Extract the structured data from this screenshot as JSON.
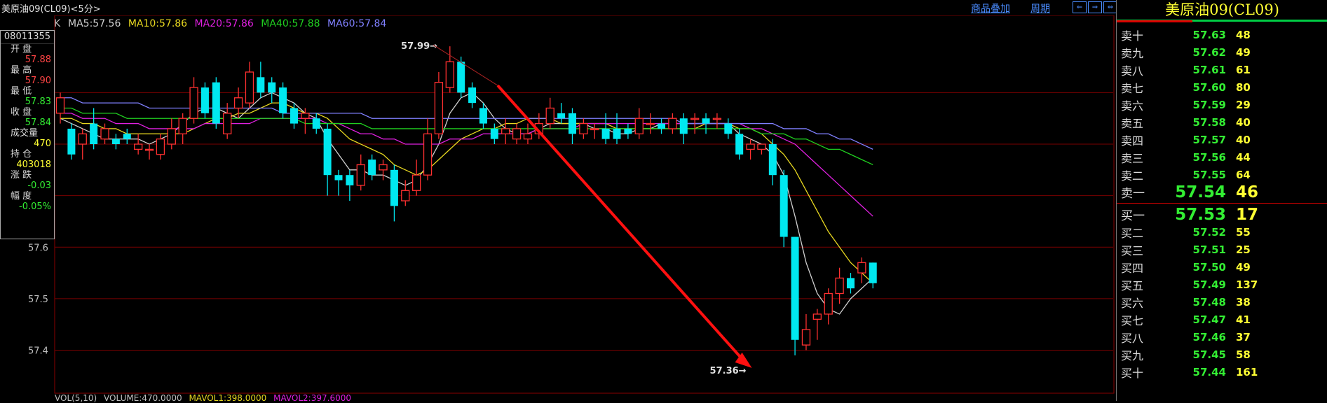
{
  "header": {
    "title": "美原油09(CL09)<5分>",
    "add_product_label": "商品叠加",
    "period_label": "周期"
  },
  "ma_legend": {
    "k_label": "K",
    "items": [
      {
        "label": "MA5:57.56",
        "color": "#d0d0d0"
      },
      {
        "label": "MA10:57.86",
        "color": "#e8d820"
      },
      {
        "label": "MA20:57.86",
        "color": "#e020e0"
      },
      {
        "label": "MA40:57.88",
        "color": "#20d020"
      },
      {
        "label": "MA60:57.84",
        "color": "#8080ff"
      }
    ]
  },
  "info": {
    "datetime": "08011355",
    "rows": [
      {
        "label": "开  盘",
        "value": "57.88",
        "color": "#ff4444"
      },
      {
        "label": "最  高",
        "value": "57.90",
        "color": "#ff4444"
      },
      {
        "label": "最  低",
        "value": "57.83",
        "color": "#33ee33"
      },
      {
        "label": "收  盘",
        "value": "57.84",
        "color": "#33ee33"
      },
      {
        "label": "成交量",
        "value": "470",
        "color": "#ffff33"
      },
      {
        "label": "持  仓",
        "value": "403018",
        "color": "#ffff33"
      },
      {
        "label": "涨  跌",
        "value": "-0.03",
        "color": "#33ee33"
      },
      {
        "label": "幅  度",
        "value": "-0.05%",
        "color": "#33ee33"
      }
    ]
  },
  "volume_legend": {
    "items": [
      {
        "label": "VOL(5,10)",
        "color": "#c0c0c0"
      },
      {
        "label": "VOLUME:470.0000",
        "color": "#c0c0c0"
      },
      {
        "label": "MAVOL1:398.0000",
        "color": "#e8d820"
      },
      {
        "label": "MAVOL2:397.6000",
        "color": "#e020e0"
      }
    ]
  },
  "colors": {
    "up": "#ff3030",
    "down": "#00e8f0",
    "grid": "#7a0000",
    "arrow": "#ff1010"
  },
  "chart_data": {
    "type": "candlestick",
    "title": "",
    "ylim": [
      57.33,
      58.05
    ],
    "yticks": [
      57.4,
      57.5,
      57.6
    ],
    "high_annotation": {
      "index": 33,
      "value": 57.99,
      "label": "57.99"
    },
    "low_annotation": {
      "index": 62,
      "value": 57.36,
      "label": "57.36"
    },
    "candles": [
      [
        57.86,
        57.89,
        57.9,
        57.84
      ],
      [
        57.83,
        57.78,
        57.84,
        57.77
      ],
      [
        57.8,
        57.82,
        57.83,
        57.77
      ],
      [
        57.84,
        57.8,
        57.87,
        57.79
      ],
      [
        57.81,
        57.83,
        57.84,
        57.8
      ],
      [
        57.81,
        57.8,
        57.82,
        57.79
      ],
      [
        57.82,
        57.81,
        57.83,
        57.8
      ],
      [
        57.79,
        57.8,
        57.82,
        57.78
      ],
      [
        57.79,
        57.79,
        57.8,
        57.77
      ],
      [
        57.78,
        57.81,
        57.82,
        57.77
      ],
      [
        57.8,
        57.83,
        57.85,
        57.79
      ],
      [
        57.82,
        57.85,
        57.86,
        57.8
      ],
      [
        57.85,
        57.91,
        57.93,
        57.84
      ],
      [
        57.91,
        57.86,
        57.92,
        57.85
      ],
      [
        57.92,
        57.84,
        57.93,
        57.83
      ],
      [
        57.82,
        57.86,
        57.88,
        57.81
      ],
      [
        57.87,
        57.89,
        57.91,
        57.85
      ],
      [
        57.88,
        57.94,
        57.96,
        57.87
      ],
      [
        57.93,
        57.9,
        57.96,
        57.89
      ],
      [
        57.92,
        57.9,
        57.93,
        57.88
      ],
      [
        57.91,
        57.86,
        57.92,
        57.85
      ],
      [
        57.87,
        57.84,
        57.88,
        57.83
      ],
      [
        57.85,
        57.86,
        57.87,
        57.82
      ],
      [
        57.85,
        57.83,
        57.86,
        57.82
      ],
      [
        57.83,
        57.74,
        57.84,
        57.7
      ],
      [
        57.74,
        57.73,
        57.75,
        57.7
      ],
      [
        57.74,
        57.72,
        57.75,
        57.69
      ],
      [
        57.72,
        57.76,
        57.78,
        57.71
      ],
      [
        57.77,
        57.74,
        57.78,
        57.73
      ],
      [
        57.75,
        57.76,
        57.77,
        57.73
      ],
      [
        57.75,
        57.68,
        57.76,
        57.65
      ],
      [
        57.69,
        57.71,
        57.73,
        57.68
      ],
      [
        57.71,
        57.74,
        57.77,
        57.7
      ],
      [
        57.74,
        57.82,
        57.85,
        57.73
      ],
      [
        57.82,
        57.92,
        57.94,
        57.81
      ],
      [
        57.91,
        57.96,
        57.99,
        57.9
      ],
      [
        57.96,
        57.9,
        57.97,
        57.89
      ],
      [
        57.91,
        57.88,
        57.92,
        57.87
      ],
      [
        57.87,
        57.84,
        57.88,
        57.83
      ],
      [
        57.83,
        57.81,
        57.84,
        57.8
      ],
      [
        57.82,
        57.83,
        57.85,
        57.8
      ],
      [
        57.81,
        57.83,
        57.84,
        57.8
      ],
      [
        57.81,
        57.82,
        57.84,
        57.8
      ],
      [
        57.82,
        57.84,
        57.86,
        57.81
      ],
      [
        57.84,
        57.87,
        57.89,
        57.83
      ],
      [
        57.86,
        57.85,
        57.88,
        57.84
      ],
      [
        57.86,
        57.82,
        57.87,
        57.8
      ],
      [
        57.82,
        57.84,
        57.85,
        57.81
      ],
      [
        57.83,
        57.83,
        57.84,
        57.81
      ],
      [
        57.83,
        57.81,
        57.86,
        57.8
      ],
      [
        57.83,
        57.81,
        57.86,
        57.8
      ],
      [
        57.83,
        57.82,
        57.84,
        57.81
      ],
      [
        57.82,
        57.85,
        57.87,
        57.81
      ],
      [
        57.84,
        57.84,
        57.86,
        57.82
      ],
      [
        57.84,
        57.83,
        57.85,
        57.82
      ],
      [
        57.83,
        57.85,
        57.86,
        57.82
      ],
      [
        57.85,
        57.82,
        57.86,
        57.8
      ],
      [
        57.85,
        57.85,
        57.86,
        57.82
      ],
      [
        57.85,
        57.84,
        57.86,
        57.82
      ],
      [
        57.85,
        57.85,
        57.86,
        57.83
      ],
      [
        57.84,
        57.82,
        57.85,
        57.81
      ],
      [
        57.82,
        57.78,
        57.83,
        57.77
      ],
      [
        57.79,
        57.8,
        57.81,
        57.77
      ],
      [
        57.79,
        57.8,
        57.8,
        57.78
      ],
      [
        57.8,
        57.74,
        57.81,
        57.72
      ],
      [
        57.74,
        57.62,
        57.75,
        57.6
      ],
      [
        57.62,
        57.42,
        57.62,
        57.39
      ],
      [
        57.41,
        57.44,
        57.47,
        57.4
      ],
      [
        57.46,
        57.47,
        57.48,
        57.42
      ],
      [
        57.47,
        57.51,
        57.52,
        57.45
      ],
      [
        57.51,
        57.54,
        57.56,
        57.49
      ],
      [
        57.54,
        57.52,
        57.55,
        57.51
      ],
      [
        57.55,
        57.57,
        57.58,
        57.53
      ],
      [
        57.57,
        57.53,
        57.57,
        57.52
      ]
    ],
    "ma_lines": [
      {
        "name": "MA5",
        "color": "#d0d0d0",
        "values": [
          57.85,
          57.84,
          57.83,
          57.82,
          57.81,
          57.81,
          57.81,
          57.81,
          57.8,
          57.81,
          57.82,
          57.84,
          57.86,
          57.87,
          57.87,
          57.86,
          57.85,
          57.87,
          57.89,
          57.9,
          57.89,
          57.88,
          57.86,
          57.85,
          57.81,
          57.78,
          57.75,
          57.75,
          57.74,
          57.74,
          57.73,
          57.72,
          57.73,
          57.76,
          57.8,
          57.86,
          57.89,
          57.9,
          57.88,
          57.85,
          57.83,
          57.82,
          57.82,
          57.83,
          57.84,
          57.84,
          57.84,
          57.84,
          57.83,
          57.83,
          57.82,
          57.82,
          57.83,
          57.83,
          57.84,
          57.84,
          57.84,
          57.84,
          57.84,
          57.84,
          57.84,
          57.82,
          57.81,
          57.8,
          57.78,
          57.74,
          57.66,
          57.57,
          57.51,
          57.48,
          57.47,
          57.5,
          57.52,
          57.54
        ]
      },
      {
        "name": "MA10",
        "color": "#e8d820",
        "values": [
          57.85,
          57.85,
          57.84,
          57.84,
          57.83,
          57.83,
          57.82,
          57.82,
          57.82,
          57.82,
          57.82,
          57.82,
          57.83,
          57.84,
          57.85,
          57.85,
          57.86,
          57.86,
          57.87,
          57.88,
          57.88,
          57.87,
          57.86,
          57.86,
          57.85,
          57.83,
          57.81,
          57.8,
          57.79,
          57.78,
          57.76,
          57.75,
          57.74,
          57.75,
          57.77,
          57.79,
          57.81,
          57.82,
          57.83,
          57.83,
          57.84,
          57.84,
          57.85,
          57.85,
          57.85,
          57.84,
          57.84,
          57.84,
          57.84,
          57.84,
          57.83,
          57.83,
          57.83,
          57.83,
          57.83,
          57.83,
          57.83,
          57.83,
          57.84,
          57.84,
          57.84,
          57.83,
          57.83,
          57.82,
          57.8,
          57.78,
          57.75,
          57.71,
          57.67,
          57.63,
          57.6,
          57.57,
          57.55,
          57.53
        ]
      },
      {
        "name": "MA20",
        "color": "#e020e0",
        "values": [
          57.86,
          57.86,
          57.85,
          57.85,
          57.85,
          57.84,
          57.84,
          57.84,
          57.83,
          57.83,
          57.83,
          57.83,
          57.83,
          57.84,
          57.84,
          57.84,
          57.84,
          57.84,
          57.85,
          57.85,
          57.85,
          57.85,
          57.85,
          57.85,
          57.84,
          57.84,
          57.83,
          57.82,
          57.82,
          57.81,
          57.81,
          57.8,
          57.8,
          57.8,
          57.8,
          57.81,
          57.81,
          57.81,
          57.82,
          57.82,
          57.82,
          57.82,
          57.82,
          57.83,
          57.83,
          57.83,
          57.83,
          57.84,
          57.84,
          57.84,
          57.84,
          57.84,
          57.84,
          57.84,
          57.84,
          57.84,
          57.84,
          57.84,
          57.84,
          57.84,
          57.84,
          57.84,
          57.83,
          57.83,
          57.82,
          57.81,
          57.8,
          57.78,
          57.76,
          57.74,
          57.72,
          57.7,
          57.68,
          57.66
        ]
      },
      {
        "name": "MA40",
        "color": "#20d020",
        "values": [
          57.87,
          57.87,
          57.86,
          57.86,
          57.86,
          57.86,
          57.85,
          57.85,
          57.85,
          57.85,
          57.85,
          57.85,
          57.85,
          57.85,
          57.85,
          57.85,
          57.85,
          57.85,
          57.85,
          57.85,
          57.85,
          57.85,
          57.84,
          57.84,
          57.84,
          57.84,
          57.84,
          57.84,
          57.83,
          57.83,
          57.83,
          57.83,
          57.83,
          57.83,
          57.83,
          57.83,
          57.83,
          57.83,
          57.83,
          57.83,
          57.83,
          57.83,
          57.83,
          57.83,
          57.83,
          57.83,
          57.83,
          57.83,
          57.83,
          57.83,
          57.83,
          57.83,
          57.83,
          57.83,
          57.83,
          57.83,
          57.83,
          57.83,
          57.83,
          57.83,
          57.83,
          57.83,
          57.83,
          57.82,
          57.82,
          57.82,
          57.81,
          57.81,
          57.8,
          57.79,
          57.79,
          57.78,
          57.77,
          57.76
        ]
      },
      {
        "name": "MA60",
        "color": "#8080ff",
        "values": [
          57.89,
          57.89,
          57.88,
          57.88,
          57.88,
          57.88,
          57.88,
          57.88,
          57.87,
          57.87,
          57.87,
          57.87,
          57.87,
          57.87,
          57.87,
          57.87,
          57.87,
          57.87,
          57.87,
          57.87,
          57.86,
          57.86,
          57.86,
          57.86,
          57.86,
          57.86,
          57.86,
          57.86,
          57.85,
          57.85,
          57.85,
          57.85,
          57.85,
          57.85,
          57.85,
          57.85,
          57.85,
          57.85,
          57.85,
          57.85,
          57.85,
          57.85,
          57.85,
          57.85,
          57.85,
          57.85,
          57.85,
          57.85,
          57.85,
          57.85,
          57.85,
          57.85,
          57.85,
          57.85,
          57.85,
          57.85,
          57.84,
          57.84,
          57.84,
          57.84,
          57.84,
          57.84,
          57.84,
          57.84,
          57.84,
          57.83,
          57.83,
          57.83,
          57.82,
          57.82,
          57.81,
          57.81,
          57.8,
          57.79
        ]
      }
    ]
  },
  "orderbook": {
    "title": "美原油09(CL09)",
    "asks": [
      {
        "label": "卖十",
        "price": "57.63",
        "qty": "48"
      },
      {
        "label": "卖九",
        "price": "57.62",
        "qty": "49"
      },
      {
        "label": "卖八",
        "price": "57.61",
        "qty": "61"
      },
      {
        "label": "卖七",
        "price": "57.60",
        "qty": "80"
      },
      {
        "label": "卖六",
        "price": "57.59",
        "qty": "29"
      },
      {
        "label": "卖五",
        "price": "57.58",
        "qty": "40"
      },
      {
        "label": "卖四",
        "price": "57.57",
        "qty": "40"
      },
      {
        "label": "卖三",
        "price": "57.56",
        "qty": "44"
      },
      {
        "label": "卖二",
        "price": "57.55",
        "qty": "64"
      }
    ],
    "ask1": {
      "label": "卖一",
      "price": "57.54",
      "qty": "46"
    },
    "bid1": {
      "label": "买一",
      "price": "57.53",
      "qty": "17"
    },
    "bids": [
      {
        "label": "买二",
        "price": "57.52",
        "qty": "55"
      },
      {
        "label": "买三",
        "price": "57.51",
        "qty": "25"
      },
      {
        "label": "买四",
        "price": "57.50",
        "qty": "49"
      },
      {
        "label": "买五",
        "price": "57.49",
        "qty": "137"
      },
      {
        "label": "买六",
        "price": "57.48",
        "qty": "38"
      },
      {
        "label": "买七",
        "price": "57.47",
        "qty": "41"
      },
      {
        "label": "买八",
        "price": "57.46",
        "qty": "37"
      },
      {
        "label": "买九",
        "price": "57.45",
        "qty": "58"
      },
      {
        "label": "买十",
        "price": "57.44",
        "qty": "161"
      }
    ]
  }
}
